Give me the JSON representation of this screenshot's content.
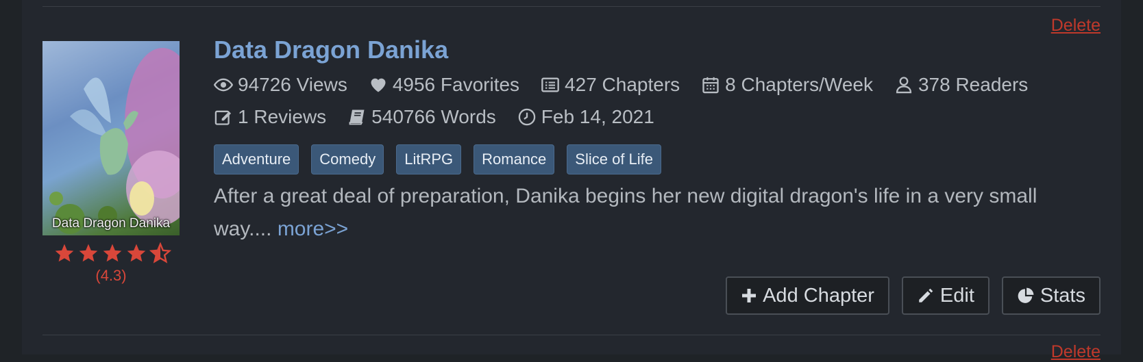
{
  "story": {
    "title": "Data Dragon Danika",
    "delete_label": "Delete",
    "cover_text": "Data Dragon Danika",
    "rating_display": "(4.3)",
    "rating_value": 4.3,
    "stats_row1": [
      {
        "icon": "eye-icon",
        "text": "94726 Views"
      },
      {
        "icon": "heart-icon",
        "text": "4956 Favorites"
      },
      {
        "icon": "list-icon",
        "text": "427 Chapters"
      },
      {
        "icon": "calendar-icon",
        "text": "8 Chapters/Week"
      },
      {
        "icon": "user-icon",
        "text": "378 Readers"
      }
    ],
    "stats_row2": [
      {
        "icon": "edit-icon",
        "text": "1 Reviews"
      },
      {
        "icon": "book-icon",
        "text": "540766 Words"
      },
      {
        "icon": "clock-icon",
        "text": "Feb 14, 2021"
      }
    ],
    "tags": [
      "Adventure",
      "Comedy",
      "LitRPG",
      "Romance",
      "Slice of Life"
    ],
    "description": "After a great deal of preparation, Danika begins her new digital dragon's life in a very small way....",
    "more_label": "more>>"
  },
  "actions": {
    "add_chapter": "Add Chapter",
    "edit": "Edit",
    "stats": "Stats"
  },
  "next_item": {
    "delete_label": "Delete"
  },
  "colors": {
    "background": "#23272e",
    "accent": "#7ba3d4",
    "danger": "#c0392b",
    "tag_bg": "#3b5878"
  }
}
